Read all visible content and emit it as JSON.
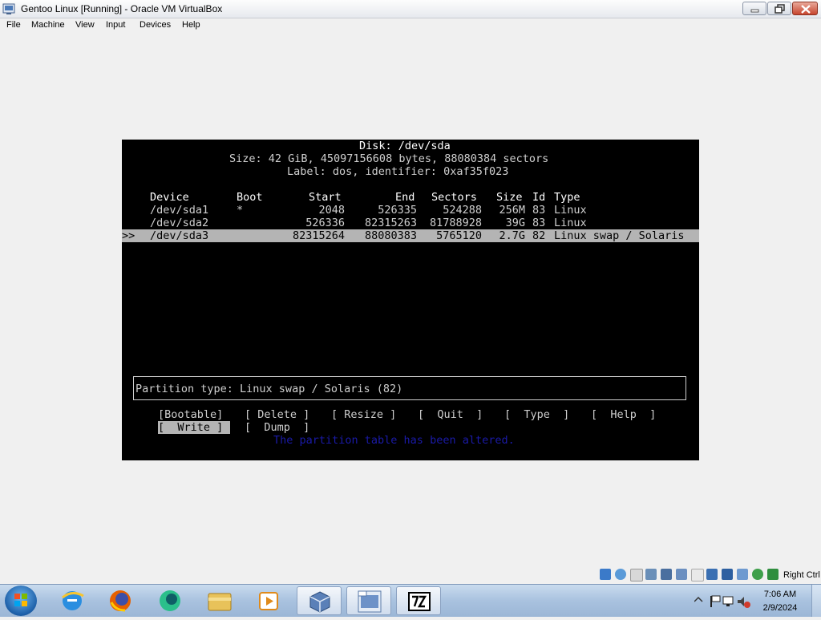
{
  "window": {
    "title": "Gentoo Linux [Running] - Oracle VM VirtualBox",
    "app_icon": "virtualbox-icon"
  },
  "menubar": {
    "items": [
      "File",
      "Machine",
      "View",
      "Input",
      "Devices",
      "Help"
    ]
  },
  "cfdisk": {
    "disk_title": "Disk: /dev/sda",
    "size_line": "Size: 42 GiB, 45097156608 bytes, 88080384 sectors",
    "label_line": "Label: dos, identifier: 0xaf35f023",
    "columns": [
      "Device",
      "Boot",
      "Start",
      "End",
      "Sectors",
      "Size",
      "Id",
      "Type"
    ],
    "rows": [
      {
        "device": "/dev/sda1",
        "boot": "*",
        "start": "2048",
        "end": "526335",
        "sectors": "524288",
        "size": "256M",
        "id": "83",
        "type": "Linux"
      },
      {
        "device": "/dev/sda2",
        "boot": "",
        "start": "526336",
        "end": "82315263",
        "sectors": "81788928",
        "size": "39G",
        "id": "83",
        "type": "Linux"
      },
      {
        "device": "/dev/sda3",
        "boot": "",
        "start": "82315264",
        "end": "88080383",
        "sectors": "5765120",
        "size": "2.7G",
        "id": "82",
        "type": "Linux swap / Solaris"
      }
    ],
    "selected_marker": ">>",
    "partition_type": "Partition type: Linux swap / Solaris (82)",
    "menu_row1": [
      "[Bootable]",
      "[ Delete ]",
      "[ Resize ]",
      "[  Quit  ]",
      "[  Type  ]",
      "[  Help  ]"
    ],
    "menu_row2": [
      "[  Write ]",
      "[  Dump  ]"
    ],
    "status_message": "The partition table has been altered."
  },
  "vm_status_bar": {
    "host_key": "Right Ctrl"
  },
  "taskbar": {
    "apps": [
      "internet-explorer-icon",
      "firefox-icon",
      "app-icon",
      "file-explorer-icon",
      "media-player-icon",
      "virtualbox-icon",
      "vm-window-icon",
      "7zip-icon"
    ],
    "time": "7:06 AM",
    "date": "2/9/2024"
  }
}
